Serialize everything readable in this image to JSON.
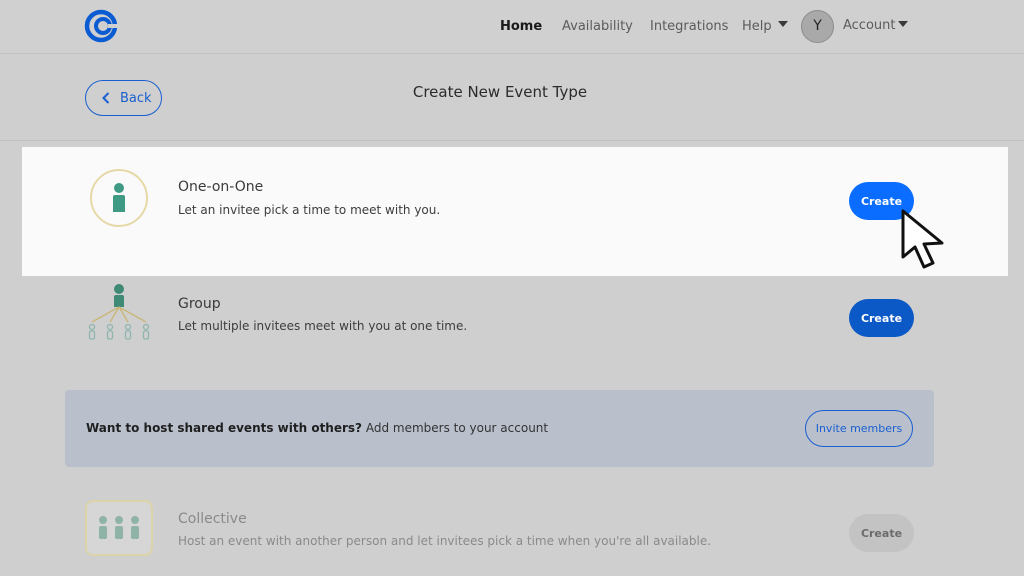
{
  "nav": {
    "home": "Home",
    "availability": "Availability",
    "integrations": "Integrations",
    "help": "Help",
    "avatar_initial": "Y",
    "account": "Account"
  },
  "header": {
    "back_label": "Back",
    "title": "Create New Event Type"
  },
  "event_types": [
    {
      "title": "One-on-One",
      "description": "Let an invitee pick a time to meet with you.",
      "button": "Create",
      "icon": "person-icon"
    },
    {
      "title": "Group",
      "description": "Let multiple invitees meet with you at one time.",
      "button": "Create",
      "icon": "group-tree-icon"
    },
    {
      "title": "Collective",
      "description": "Host an event with another person and let invitees pick a time when you're all available.",
      "button": "Create",
      "icon": "team-icon"
    }
  ],
  "invite_banner": {
    "bold": "Want to host shared events with others?",
    "text": " Add members to your account",
    "button": "Invite members"
  },
  "colors": {
    "primary": "#0a6dff",
    "primary_dark": "#0b58c7",
    "link_blue": "#1a5fd0",
    "highlight": "#fafafa",
    "overlay": "#cfcfcf"
  }
}
